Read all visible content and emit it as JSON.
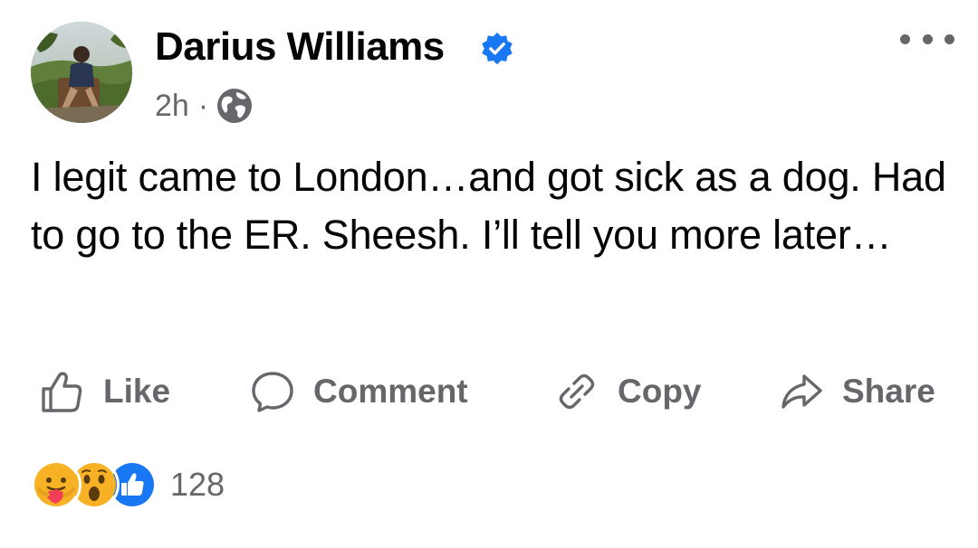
{
  "post": {
    "author_name": "Darius Williams",
    "verified": true,
    "timestamp": "2h",
    "separator": "·",
    "audience_icon": "globe-icon",
    "text": "I legit came to London…and got sick as a dog. Had to go to the ER. Sheesh. I’ll tell you more later…"
  },
  "actions": {
    "like": "Like",
    "comment": "Comment",
    "copy": "Copy",
    "share": "Share"
  },
  "reactions": {
    "icons": [
      "care-reaction-icon",
      "wow-reaction-icon",
      "like-reaction-icon"
    ],
    "count": "128"
  },
  "colors": {
    "verified_blue": "#1877f2",
    "secondary_text": "#65676b",
    "primary_text": "#050505"
  }
}
